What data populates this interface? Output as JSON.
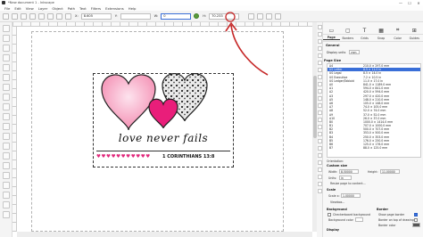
{
  "window": {
    "title": "*New document 1 - Inkscape",
    "controls": [
      "—",
      "☐",
      "✕"
    ]
  },
  "menu": [
    "File",
    "Edit",
    "View",
    "Layer",
    "Object",
    "Path",
    "Text",
    "Filters",
    "Extensions",
    "Help"
  ],
  "toolbar": {
    "x_label": "X:",
    "x_value": "8.605",
    "y_label": "Y:",
    "y_value": "",
    "w_label": "W:",
    "w_value": "0",
    "h_label": "H:",
    "h_value": "70.233"
  },
  "canvas": {
    "artwork_text": "love never fails",
    "verse_text": "1 CORINTHIANS 13:8",
    "mini_hearts": "♥♥♥♥♥♥♥♥♥♥♥",
    "colors": {
      "pink_heart": "#f48fb3",
      "hot_pink": "#e91e7a",
      "leopard_bg": "#e8e8e8",
      "annotation_red": "#c62828"
    }
  },
  "panel": {
    "icons": [
      "page-icon",
      "borders-icon",
      "text-icon",
      "grid-icon",
      "snap-icon",
      "guides-icon"
    ],
    "tabs": [
      "Page",
      "Borders",
      "Grids",
      "Snap",
      "Color",
      "Guides"
    ],
    "active_tab": "Page",
    "general_title": "General",
    "display_units_label": "Display units",
    "display_units_value": "mm",
    "page_size_title": "Page Size",
    "size_table_header": [
      "",
      ""
    ],
    "sizes": [
      {
        "name": "A4",
        "dims": "210.0 × 297.0 mm"
      },
      {
        "name": "US Letter",
        "dims": "8.5 × 11.0 in"
      },
      {
        "name": "US Legal",
        "dims": "8.5 × 14.0 in"
      },
      {
        "name": "US Executive",
        "dims": "7.2 × 10.5 in"
      },
      {
        "name": "US Ledger/Tabloid",
        "dims": "11.0 × 17.0 in"
      },
      {
        "name": "A0",
        "dims": "841.0 × 1189.0 mm"
      },
      {
        "name": "A1",
        "dims": "594.0 × 841.0 mm"
      },
      {
        "name": "A2",
        "dims": "420.0 × 594.0 mm"
      },
      {
        "name": "A3",
        "dims": "297.0 × 420.0 mm"
      },
      {
        "name": "A5",
        "dims": "148.0 × 210.0 mm"
      },
      {
        "name": "A6",
        "dims": "105.0 × 148.0 mm"
      },
      {
        "name": "A7",
        "dims": "74.0 × 105.0 mm"
      },
      {
        "name": "A8",
        "dims": "52.0 × 74.0 mm"
      },
      {
        "name": "A9",
        "dims": "37.0 × 52.0 mm"
      },
      {
        "name": "A10",
        "dims": "26.0 × 37.0 mm"
      },
      {
        "name": "B0",
        "dims": "1000.0 × 1414.0 mm"
      },
      {
        "name": "B1",
        "dims": "707.0 × 1000.0 mm"
      },
      {
        "name": "B2",
        "dims": "500.0 × 707.0 mm"
      },
      {
        "name": "B3",
        "dims": "353.0 × 500.0 mm"
      },
      {
        "name": "B4",
        "dims": "250.0 × 353.0 mm"
      },
      {
        "name": "B5",
        "dims": "176.0 × 250.0 mm"
      },
      {
        "name": "B6",
        "dims": "125.0 × 176.0 mm"
      },
      {
        "name": "B7",
        "dims": "88.0 × 125.0 mm"
      }
    ],
    "selected_size_index": 1,
    "orientation_label": "Orientation:",
    "custom_size_title": "Custom size",
    "width_label": "Width:",
    "width_value": "8.50000",
    "height_label": "Height:",
    "height_value": "11.00000",
    "units_label": "Units:",
    "units_value": "in",
    "resize_label": "Resize page to content...",
    "scale_title": "Scale",
    "scale_label": "Scale x:",
    "scale_value": "1.00000",
    "viewbox_label": "Viewbox...",
    "background_title": "Background",
    "checkerboard_label": "Checkerboard background",
    "bgcolor_label": "Background color",
    "border_title": "Border",
    "show_border_label": "Show page border",
    "border_top_label": "Border on top of drawing",
    "border_color_label": "Border color",
    "display_title": "Display"
  }
}
